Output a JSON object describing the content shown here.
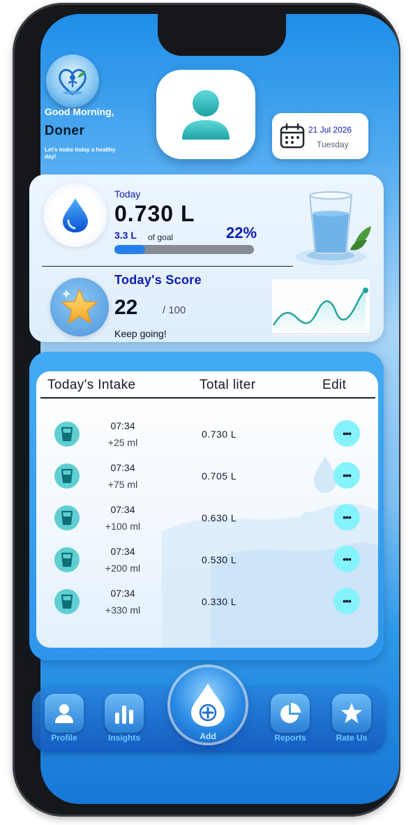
{
  "header": {
    "greeting": "Good Morning,",
    "user_name": "Doner",
    "tagline": "Let's make today a healthy day!",
    "date": "21 Jul 2026",
    "weekday": "Tuesday"
  },
  "stats": {
    "today_label": "Today",
    "today_value": "0.730 L",
    "goal_value": "3.3 L",
    "goal_suffix": "of goal",
    "percent_text": "22%",
    "progress_fraction": 0.22,
    "score_label": "Today's Score",
    "score_value": "22",
    "score_max": "/ 100",
    "score_message": "Keep going!"
  },
  "intake": {
    "headers": [
      "Today's Intake",
      "Total liter",
      "Edit"
    ],
    "edit_glyph": "•••",
    "rows": [
      {
        "time": "07:34",
        "amount": "+25 ml",
        "total": "0.730 L"
      },
      {
        "time": "07:34",
        "amount": "+75 ml",
        "total": "0.705 L"
      },
      {
        "time": "07:34",
        "amount": "+100 ml",
        "total": "0.630 L"
      },
      {
        "time": "07:34",
        "amount": "+200 ml",
        "total": "0.530 L"
      },
      {
        "time": "07:34",
        "amount": "+330 ml",
        "total": "0.330 L"
      }
    ]
  },
  "nav": {
    "profile": "Profile",
    "insights": "Insights",
    "add": "Add",
    "reports": "Reports",
    "rate": "Rate Us"
  },
  "colors": {
    "accent_blue": "#0c1bb8",
    "progress_fill": "#2580ea",
    "teal": "#5fcfd3",
    "edit_button": "#85f3fb"
  }
}
